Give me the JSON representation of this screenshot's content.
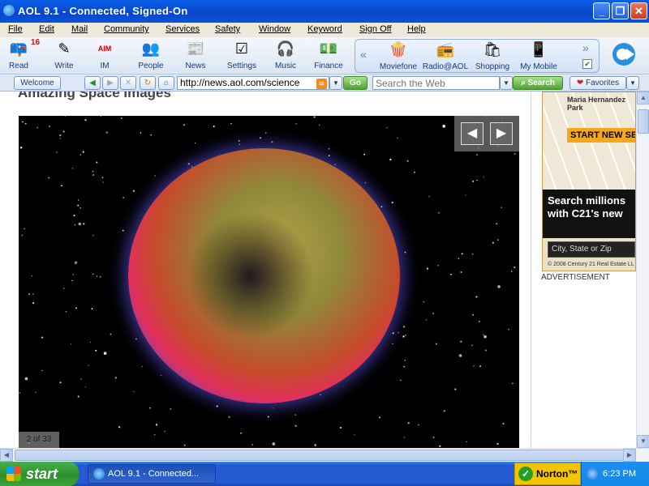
{
  "window": {
    "title": "AOL 9.1 - Connected, Signed-On",
    "min": "_",
    "max": "❐",
    "close": "✕"
  },
  "menu": [
    "File",
    "Edit",
    "Mail",
    "Community",
    "Services",
    "Safety",
    "Window",
    "Keyword",
    "Sign Off",
    "Help"
  ],
  "toolbar": {
    "badge": "16",
    "items": [
      {
        "label": "Read",
        "icon": "mailbox-icon",
        "glyph": "📪"
      },
      {
        "label": "Write",
        "icon": "write-icon",
        "glyph": "✎"
      },
      {
        "label": "IM",
        "icon": "aim-icon",
        "glyph": "AIM"
      },
      {
        "label": "People",
        "icon": "people-icon",
        "glyph": "👥"
      },
      {
        "label": "News",
        "icon": "news-icon",
        "glyph": "📰"
      },
      {
        "label": "Settings",
        "icon": "settings-icon",
        "glyph": "☑"
      },
      {
        "label": "Music",
        "icon": "music-icon",
        "glyph": "🎧"
      },
      {
        "label": "Finance",
        "icon": "finance-icon",
        "glyph": "💵"
      }
    ],
    "panel": [
      {
        "label": "Moviefone",
        "icon": "moviefone-icon",
        "glyph": "🍿"
      },
      {
        "label": "Radio@AOL",
        "icon": "radio-icon",
        "glyph": "📻"
      },
      {
        "label": "Shopping",
        "icon": "shopping-icon",
        "glyph": "🛍"
      },
      {
        "label": "My Mobile",
        "icon": "mobile-icon",
        "glyph": "📱"
      }
    ],
    "panel_left": "«",
    "panel_right": "»",
    "panel_check": "✔"
  },
  "nav": {
    "welcome": "Welcome",
    "back": "◀",
    "forward": "▶",
    "stop": "✕",
    "refresh": "↻",
    "home": "⌂",
    "url": "http://news.aol.com/science",
    "rss": "≋",
    "url_drop": "▼",
    "go": "Go",
    "search_placeholder": "Search the Web",
    "search_drop": "▼",
    "search_btn": "Search",
    "favorites": "Favorites",
    "favorites_drop": "▼"
  },
  "content": {
    "heading": "Amazing Space Images",
    "prev": "◀",
    "next": "▶",
    "counter": "2 of 33",
    "ad": {
      "park": "Maria Hernandez Park",
      "start": "START NEW SE",
      "headline": "Search millions with C21's new",
      "field": "City, State or Zip",
      "copyright": "© 2008 Century 21 Real Estate LL",
      "label": "ADVERTISEMENT"
    }
  },
  "scroll": {
    "up": "▲",
    "down": "▼",
    "left": "◀",
    "right": "▶"
  },
  "taskbar": {
    "start": "start",
    "item": "AOL 9.1 - Connected...",
    "norton": "Norton™",
    "time": "6:23 PM"
  }
}
